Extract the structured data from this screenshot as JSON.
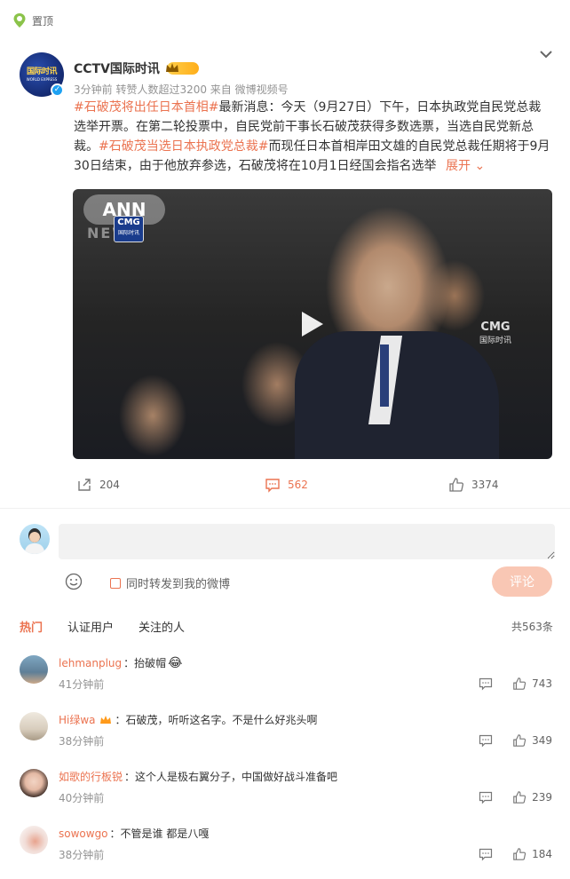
{
  "colors": {
    "accent": "#eb7350",
    "muted": "#939393",
    "verified": "#1da1f2",
    "pinned_green": "#44bb44"
  },
  "pinned": {
    "label": "置顶"
  },
  "post": {
    "author": "CCTV国际时讯",
    "avatar_text": "国际时讯",
    "avatar_sub": "WORLD EXPRESS",
    "meta": "3分钟前 转赞人数超过3200 来自 微博视频号",
    "text": {
      "topic1": "#石破茂将出任日本首相#",
      "part1": "最新消息：今天（9月27日）下午，日本执政党自民党总裁选举开票。在第二轮投票中，自民党前干事长石破茂获得多数选票，当选自民党新总裁。",
      "topic2": "#石破茂当选日本执政党总裁#",
      "part2": "而现任日本首相岸田文雄的自民党总裁任期将于9月30日结束，由于他放弃参选，石破茂将在10月1日经国会指名选举",
      "expand": "展开"
    },
    "video": {
      "watermark_ann": "ANN",
      "watermark_news": "NEWS",
      "cmg_logo": "CMG",
      "cmg_sub": "国际时讯",
      "cmg_right": "CMG",
      "cmg_right_sub": "国际时讯"
    },
    "actions": {
      "repost": "204",
      "comment": "562",
      "like": "3374"
    }
  },
  "composer": {
    "placeholder": "",
    "repost_checkbox_label": "同时转发到我的微博",
    "submit_label": "评论"
  },
  "comments_header": {
    "tabs": [
      "热门",
      "认证用户",
      "关注的人"
    ],
    "total": "共563条"
  },
  "comments": [
    {
      "user": "lehmanplug",
      "text": "：抬破帽",
      "emoji": "😂",
      "time": "41分钟前",
      "likes": "743"
    },
    {
      "user": "Hi绿wa",
      "text": "：石破茂，听听这名字。不是什么好兆头啊",
      "time": "38分钟前",
      "likes": "349"
    },
    {
      "user": "如歌的行板锐",
      "text": "：这个人是极右翼分子，中国做好战斗准备吧",
      "time": "40分钟前",
      "likes": "239"
    },
    {
      "user": "sowowgo",
      "text": "：不管是谁 都是八嘎",
      "time": "38分钟前",
      "likes": "184"
    }
  ]
}
